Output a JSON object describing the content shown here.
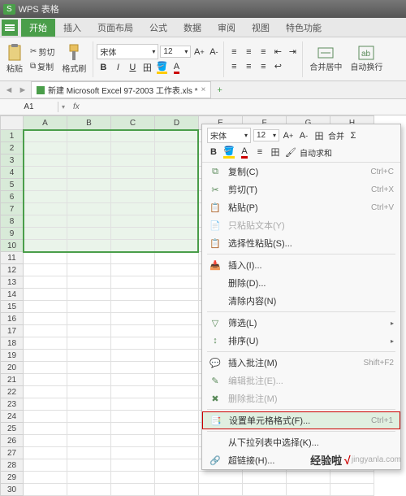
{
  "title": {
    "app": "WPS 表格",
    "badge": "S"
  },
  "tabs": [
    "开始",
    "插入",
    "页面布局",
    "公式",
    "数据",
    "审阅",
    "视图",
    "特色功能"
  ],
  "ribbon": {
    "paste": "粘贴",
    "cut": "剪切",
    "copy": "复制",
    "fmtpainter": "格式刷",
    "font": "宋体",
    "size": "12",
    "merge": "合并居中",
    "autosum": "自动换行"
  },
  "doctab": "新建 Microsoft Excel 97-2003 工作表.xls  *",
  "namebox": "A1",
  "cols": [
    "A",
    "B",
    "C",
    "D",
    "E",
    "F",
    "G",
    "H"
  ],
  "rows": [
    "1",
    "2",
    "3",
    "4",
    "5",
    "6",
    "7",
    "8",
    "9",
    "10",
    "11",
    "12",
    "13",
    "14",
    "15",
    "16",
    "17",
    "18",
    "19",
    "20",
    "21",
    "22",
    "23",
    "24",
    "25",
    "26",
    "27",
    "28",
    "29",
    "30"
  ],
  "mini": {
    "font": "宋体",
    "size": "12",
    "merge": "合并",
    "sum": "自动求和"
  },
  "ctx": {
    "copy": "复制(C)",
    "copysc": "Ctrl+C",
    "cut": "剪切(T)",
    "cutsc": "Ctrl+X",
    "paste": "粘贴(P)",
    "pastesc": "Ctrl+V",
    "pastetext": "只粘贴文本(Y)",
    "pastespecial": "选择性粘贴(S)...",
    "insert": "插入(I)...",
    "delete": "删除(D)...",
    "clear": "清除内容(N)",
    "filter": "筛选(L)",
    "sort": "排序(U)",
    "inscomment": "插入批注(M)",
    "inscommentsc": "Shift+F2",
    "editcomment": "编辑批注(E)...",
    "delcomment": "删除批注(M)",
    "fmtcells": "设置单元格格式(F)...",
    "fmtcellssc": "Ctrl+1",
    "picklist": "从下拉列表中选择(K)...",
    "hyperlink": "超链接(H)..."
  },
  "watermark": {
    "a": "经验啦",
    "b": "jingyanla.com"
  }
}
